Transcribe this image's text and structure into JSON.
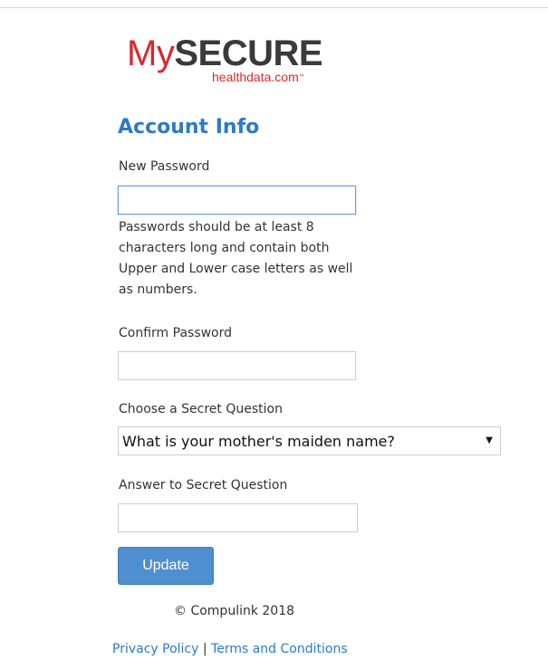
{
  "logo": {
    "my": "My",
    "secure": "SECURE",
    "sub": "healthdata.com",
    "tm": "™"
  },
  "heading": "Account Info",
  "new_password": {
    "label": "New Password",
    "value": "",
    "hint": "Passwords should be at least 8 characters long and contain both Upper and Lower case letters as well as numbers."
  },
  "confirm_password": {
    "label": "Confirm Password",
    "value": ""
  },
  "secret_question": {
    "label": "Choose a Secret Question",
    "selected": "What is your mother's maiden name?"
  },
  "secret_answer": {
    "label": "Answer to Secret Question",
    "value": ""
  },
  "update_button": "Update",
  "footer": {
    "copyright": "© Compulink 2018",
    "privacy": "Privacy Policy",
    "separator": " | ",
    "terms": "Terms and Conditions"
  },
  "colors": {
    "accent": "#2d7ac8",
    "brand_red": "#d7282f",
    "button": "#4f8fd0"
  },
  "icons": {
    "select_arrow": "triangle-down-icon"
  }
}
